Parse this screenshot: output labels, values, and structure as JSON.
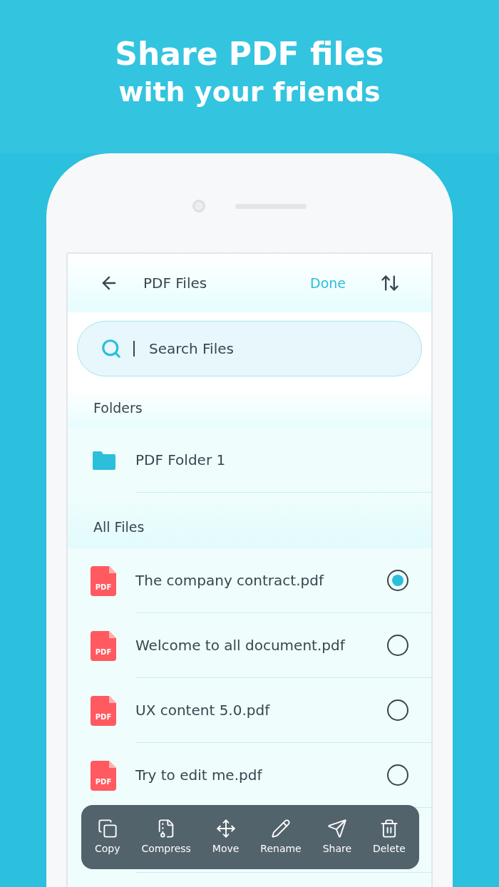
{
  "headline": {
    "title": "Share PDF files",
    "subtitle": "with your friends"
  },
  "app_bar": {
    "title": "PDF Files",
    "action": "Done"
  },
  "search": {
    "placeholder": "Search Files"
  },
  "folders": {
    "heading": "Folders",
    "items": [
      {
        "name": "PDF Folder 1"
      }
    ]
  },
  "files": {
    "heading": "All Files",
    "items": [
      {
        "name": "The company contract.pdf",
        "icon_label": "PDF",
        "selected": true
      },
      {
        "name": "Welcome to all document.pdf",
        "icon_label": "PDF",
        "selected": false
      },
      {
        "name": "UX content 5.0.pdf",
        "icon_label": "PDF",
        "selected": false
      },
      {
        "name": "Try to edit me.pdf",
        "icon_label": "PDF",
        "selected": false
      }
    ]
  },
  "toolbar": [
    {
      "kind": "copy",
      "label": "Copy"
    },
    {
      "kind": "compress",
      "label": "Compress"
    },
    {
      "kind": "move",
      "label": "Move"
    },
    {
      "kind": "rename",
      "label": "Rename"
    },
    {
      "kind": "share",
      "label": "Share"
    },
    {
      "kind": "delete",
      "label": "Delete"
    }
  ]
}
